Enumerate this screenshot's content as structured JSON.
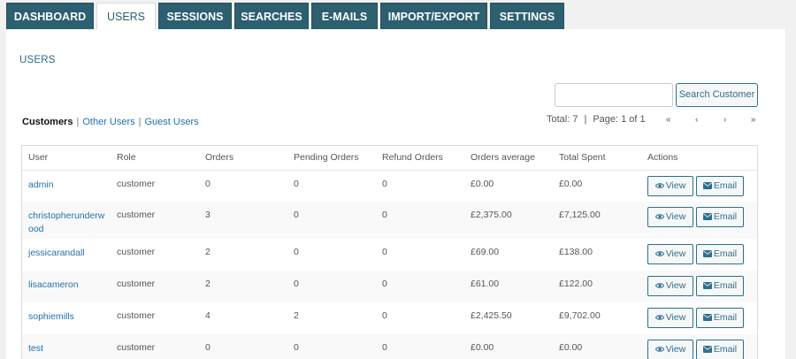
{
  "tabs": [
    {
      "label": "DASHBOARD",
      "active": false
    },
    {
      "label": "USERS",
      "active": true
    },
    {
      "label": "SESSIONS",
      "active": false
    },
    {
      "label": "SEARCHES",
      "active": false
    },
    {
      "label": "E-MAILS",
      "active": false
    },
    {
      "label": "IMPORT/EXPORT",
      "active": false
    },
    {
      "label": "SETTINGS",
      "active": false
    }
  ],
  "section_title": "USERS",
  "search": {
    "value": "",
    "placeholder": "",
    "button_label": "Search Customer"
  },
  "filters": {
    "current": "Customers",
    "links": [
      "Other Users",
      "Guest Users"
    ]
  },
  "pagination": {
    "total": "Total: 7",
    "page": "Page: 1 of 1",
    "first": "«",
    "prev": "‹",
    "next": "›",
    "last": "»"
  },
  "table": {
    "headers": [
      "User",
      "Role",
      "Orders",
      "Pending Orders",
      "Refund Orders",
      "Orders average",
      "Total Spent",
      "Actions"
    ],
    "rows": [
      {
        "user": "admin",
        "role": "customer",
        "orders": "0",
        "pending": "0",
        "refund": "0",
        "average": "£0.00",
        "total": "£0.00"
      },
      {
        "user": "christopherunderwood",
        "role": "customer",
        "orders": "3",
        "pending": "0",
        "refund": "0",
        "average": "£2,375.00",
        "total": "£7,125.00"
      },
      {
        "user": "jessicarandall",
        "role": "customer",
        "orders": "2",
        "pending": "0",
        "refund": "0",
        "average": "£69.00",
        "total": "£138.00"
      },
      {
        "user": "lisacameron",
        "role": "customer",
        "orders": "2",
        "pending": "0",
        "refund": "0",
        "average": "£61.00",
        "total": "£122.00"
      },
      {
        "user": "sophiemills",
        "role": "customer",
        "orders": "4",
        "pending": "2",
        "refund": "0",
        "average": "£2,425.50",
        "total": "£9,702.00"
      },
      {
        "user": "test",
        "role": "customer",
        "orders": "0",
        "pending": "0",
        "refund": "0",
        "average": "£0.00",
        "total": "£0.00"
      }
    ],
    "view_label": "View",
    "email_label": "Email"
  },
  "icons": {
    "view": "eye-icon",
    "email": "envelope-icon"
  },
  "colors": {
    "tab_bg": "#2c5f70",
    "accent": "#2271b1",
    "button_border": "#2e6f8e"
  }
}
